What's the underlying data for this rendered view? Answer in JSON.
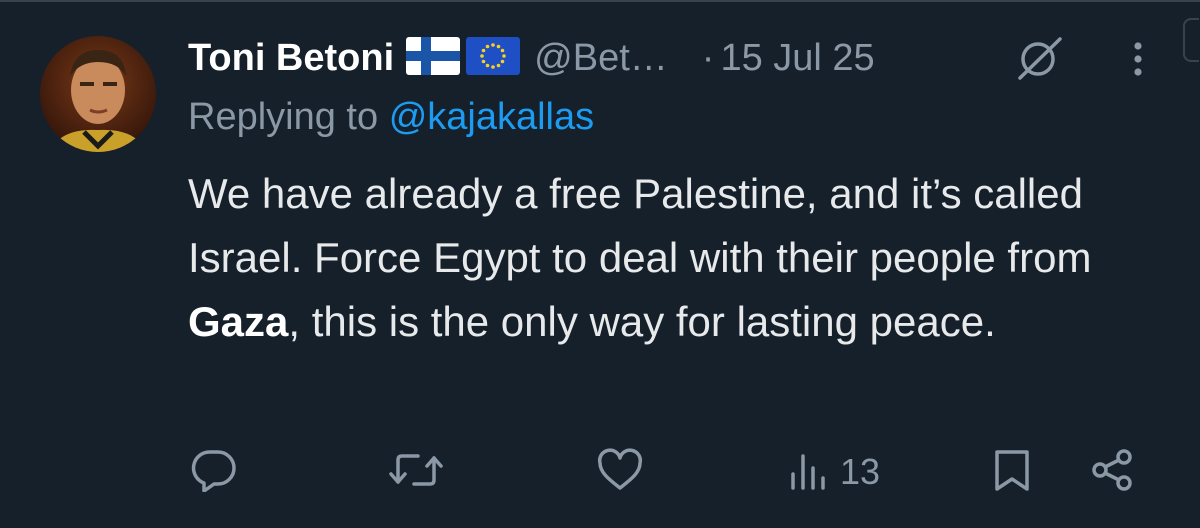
{
  "tweet": {
    "author_name": "Toni Betoni",
    "author_handle": "@Bet…",
    "separator": "·",
    "date": "15 Jul 25",
    "reply_prefix": "Replying to",
    "reply_handle": "@kajakallas",
    "text_part1": "We have already a free Palestine, and it’s called Israel. Force Egypt to deal with their people from ",
    "text_bold": "Gaza",
    "text_part2": ", this is the only way for lasting peace.",
    "views_count": "13"
  },
  "flags": [
    "finland-flag-icon",
    "eu-flag-icon"
  ],
  "icons": [
    "grok-icon",
    "more-icon",
    "reply-icon",
    "retweet-icon",
    "like-icon",
    "views-icon",
    "bookmark-icon",
    "share-icon"
  ],
  "colors": {
    "background": "#15202b",
    "text": "#e7e9ea",
    "muted": "#8b98a5",
    "link": "#1d9bf0"
  }
}
